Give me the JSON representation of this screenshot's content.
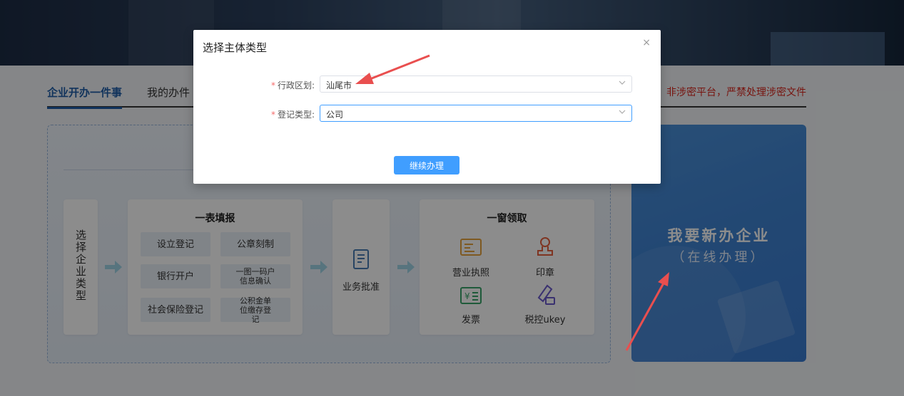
{
  "tabs": [
    {
      "label": "企业开办一件事",
      "active": true
    },
    {
      "label": "我的办件",
      "active": false
    }
  ],
  "warning": "非涉密平台，严禁处理涉密文件",
  "process": {
    "step1": "选择企业类型",
    "form_card": {
      "title": "一表填报",
      "items": [
        "设立登记",
        "公章刻制",
        "银行开户",
        "一图一码户信息确认",
        "社会保险登记",
        "公积金单位缴存登记"
      ]
    },
    "approval": {
      "label": "业务批准",
      "icon": "document-check-icon"
    },
    "collect_card": {
      "title": "一窗领取",
      "items": [
        {
          "label": "营业执照",
          "icon": "license-icon"
        },
        {
          "label": "印章",
          "icon": "stamp-icon"
        },
        {
          "label": "发票",
          "icon": "invoice-icon"
        },
        {
          "label": "税控ukey",
          "icon": "ukey-icon"
        }
      ]
    }
  },
  "new_business": {
    "title": "我要新办企业",
    "subtitle": "（在线办理）"
  },
  "dialog": {
    "title": "选择主体类型",
    "close": "×",
    "fields": [
      {
        "label": "行政区划:",
        "required": true,
        "value": "汕尾市"
      },
      {
        "label": "登记类型:",
        "required": true,
        "value": "公司"
      }
    ],
    "submit": "继续办理"
  },
  "colors": {
    "primary": "#409eff",
    "tab_active": "#1f5ea8",
    "warning": "#d9261c",
    "annotation_arrow": "#e94f4f"
  }
}
